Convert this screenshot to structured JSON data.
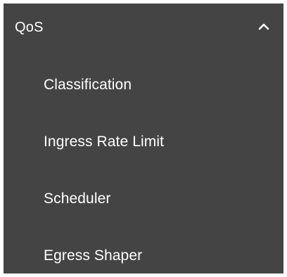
{
  "menu": {
    "title": "QoS",
    "expanded": true,
    "toggle_icon": "chevron-up-icon",
    "background_color": "#444444",
    "text_color": "#ffffff",
    "items": [
      {
        "label": "Classification"
      },
      {
        "label": "Ingress Rate Limit"
      },
      {
        "label": "Scheduler"
      },
      {
        "label": "Egress Shaper"
      }
    ]
  }
}
